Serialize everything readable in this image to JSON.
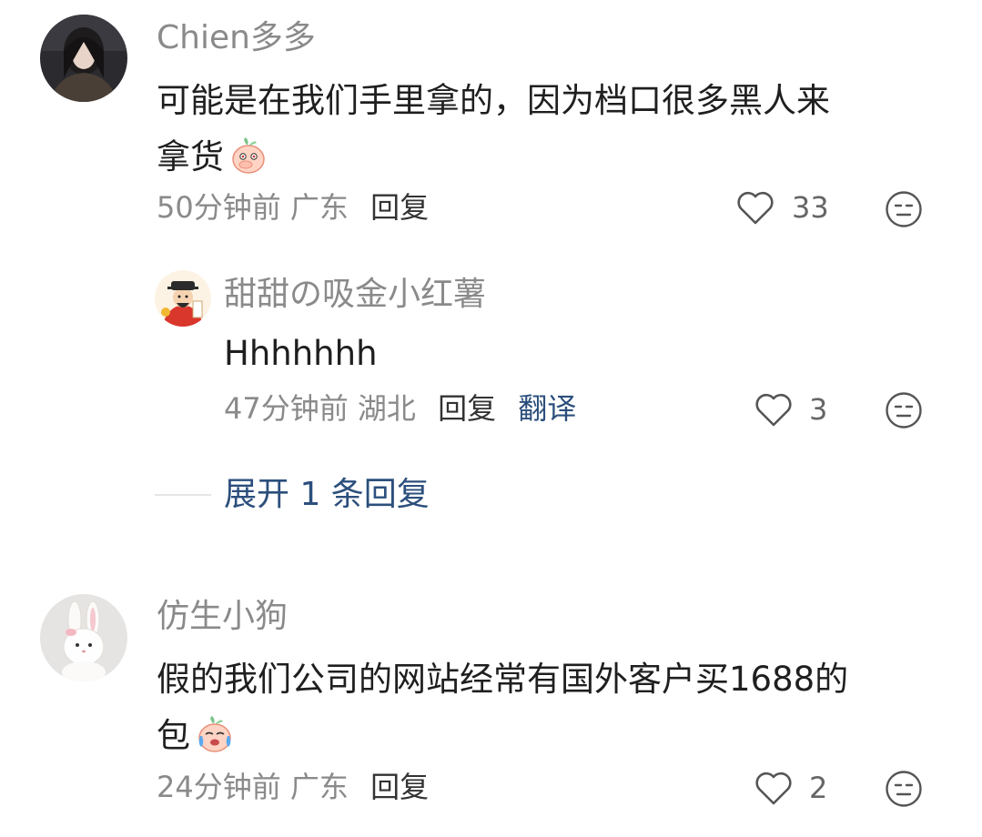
{
  "comments": [
    {
      "username": "Chien多多",
      "text_line1": "可能是在我们手里拿的，因为档口很多黑人来",
      "text_line2": "拿货",
      "emoji_icon": "peach-covering-mouth-emoji",
      "time": "50分钟前",
      "location": "广东",
      "reply_label": "回复",
      "likes": "33"
    },
    {
      "username": "甜甜の吸金小红薯",
      "text": "Hhhhhhh",
      "time": "47分钟前",
      "location": "湖北",
      "reply_label": "回复",
      "translate_label": "翻译",
      "likes": "3"
    },
    {
      "username": "仿生小狗",
      "text_line1": "假的我们公司的网站经常有国外客户买1688的",
      "text_line2": "包",
      "emoji_icon": "peach-crying-emoji",
      "time": "24分钟前",
      "location": "广东",
      "reply_label": "回复",
      "likes": "2"
    }
  ],
  "expand_replies": "展开 1 条回复",
  "icons": {
    "like": "heart-outline-icon",
    "dislike": "unamused-face-icon"
  },
  "colors": {
    "link": "#2c4f7c",
    "muted": "#8a8a8a"
  }
}
